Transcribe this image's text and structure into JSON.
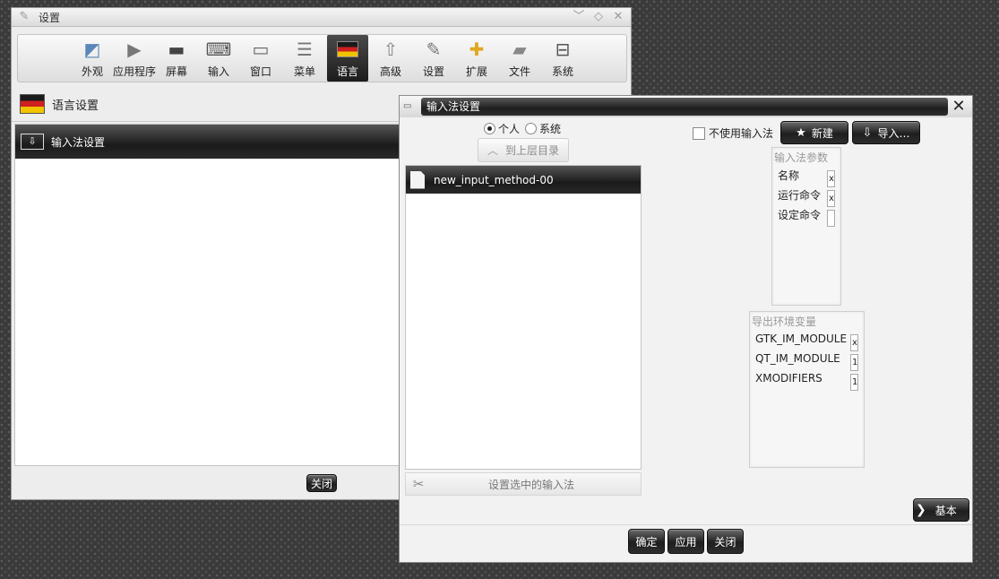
{
  "main_window": {
    "title": "设置",
    "toolbar": [
      {
        "label": "外观",
        "icon": "appearance-icon"
      },
      {
        "label": "应用程序",
        "icon": "applications-icon"
      },
      {
        "label": "屏幕",
        "icon": "screen-icon"
      },
      {
        "label": "输入",
        "icon": "input-icon"
      },
      {
        "label": "窗口",
        "icon": "window-icon"
      },
      {
        "label": "菜单",
        "icon": "menu-icon"
      },
      {
        "label": "语言",
        "icon": "flag-icon",
        "active": true
      },
      {
        "label": "高级",
        "icon": "rocket-icon"
      },
      {
        "label": "设置",
        "icon": "wrench-icon"
      },
      {
        "label": "扩展",
        "icon": "puzzle-icon"
      },
      {
        "label": "文件",
        "icon": "folder-icon"
      },
      {
        "label": "系统",
        "icon": "laptop-icon"
      }
    ],
    "section_title": "语言设置",
    "selected_item": "输入法设置",
    "close_label": "关闭"
  },
  "im_window": {
    "title": "输入法设置",
    "radio_personal": "个人",
    "radio_system": "系统",
    "up_dir": "到上层目录",
    "list": [
      "new_input_method-00"
    ],
    "configure_selected": "设置选中的输入法",
    "no_im_label": "不使用输入法",
    "new_label": "新建",
    "import_label": "导入…",
    "params": {
      "title": "输入法参数",
      "fields": [
        {
          "label": "名称",
          "value": "x"
        },
        {
          "label": "运行命令",
          "value": "x"
        },
        {
          "label": "设定命令",
          "value": ""
        }
      ]
    },
    "env": {
      "title": "导出环境变量",
      "fields": [
        {
          "label": "GTK_IM_MODULE",
          "value": "x"
        },
        {
          "label": "QT_IM_MODULE",
          "value": "1"
        },
        {
          "label": "XMODIFIERS",
          "value": "1"
        }
      ]
    },
    "basic_label": "基本",
    "ok_label": "确定",
    "apply_label": "应用",
    "close_label": "关闭"
  },
  "colors": {
    "selection_dark": "#1a1a1a",
    "window_bg": "#ededed",
    "flag_black": "#1a1a1a",
    "flag_red": "#d02020",
    "flag_gold": "#f0c400"
  }
}
